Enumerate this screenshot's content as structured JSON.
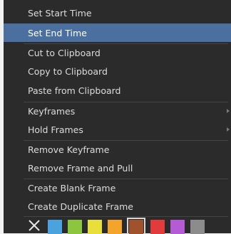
{
  "menu": {
    "items": [
      {
        "label": "Set Start Time"
      },
      {
        "label": "Set End Time"
      },
      {
        "label": "Cut to Clipboard"
      },
      {
        "label": "Copy to Clipboard"
      },
      {
        "label": "Paste from Clipboard"
      },
      {
        "label": "Keyframes"
      },
      {
        "label": "Hold Frames"
      },
      {
        "label": "Remove Keyframe"
      },
      {
        "label": "Remove Frame and Pull"
      },
      {
        "label": "Create Blank Frame"
      },
      {
        "label": "Create Duplicate Frame"
      }
    ],
    "highlighted_index": 1
  },
  "colors": {
    "menu_bg": "#2b2b2b",
    "highlight": "#4b6f9e",
    "text": "#dcdcdc"
  },
  "swatches": [
    {
      "color": "#4aa3df"
    },
    {
      "color": "#8cc63f"
    },
    {
      "color": "#e8df3a"
    },
    {
      "color": "#f2a52a"
    },
    {
      "color": "#a0522d",
      "selected": true
    },
    {
      "color": "#e23b3b"
    },
    {
      "color": "#b55bd6"
    },
    {
      "color": "#8c8c8c"
    }
  ]
}
